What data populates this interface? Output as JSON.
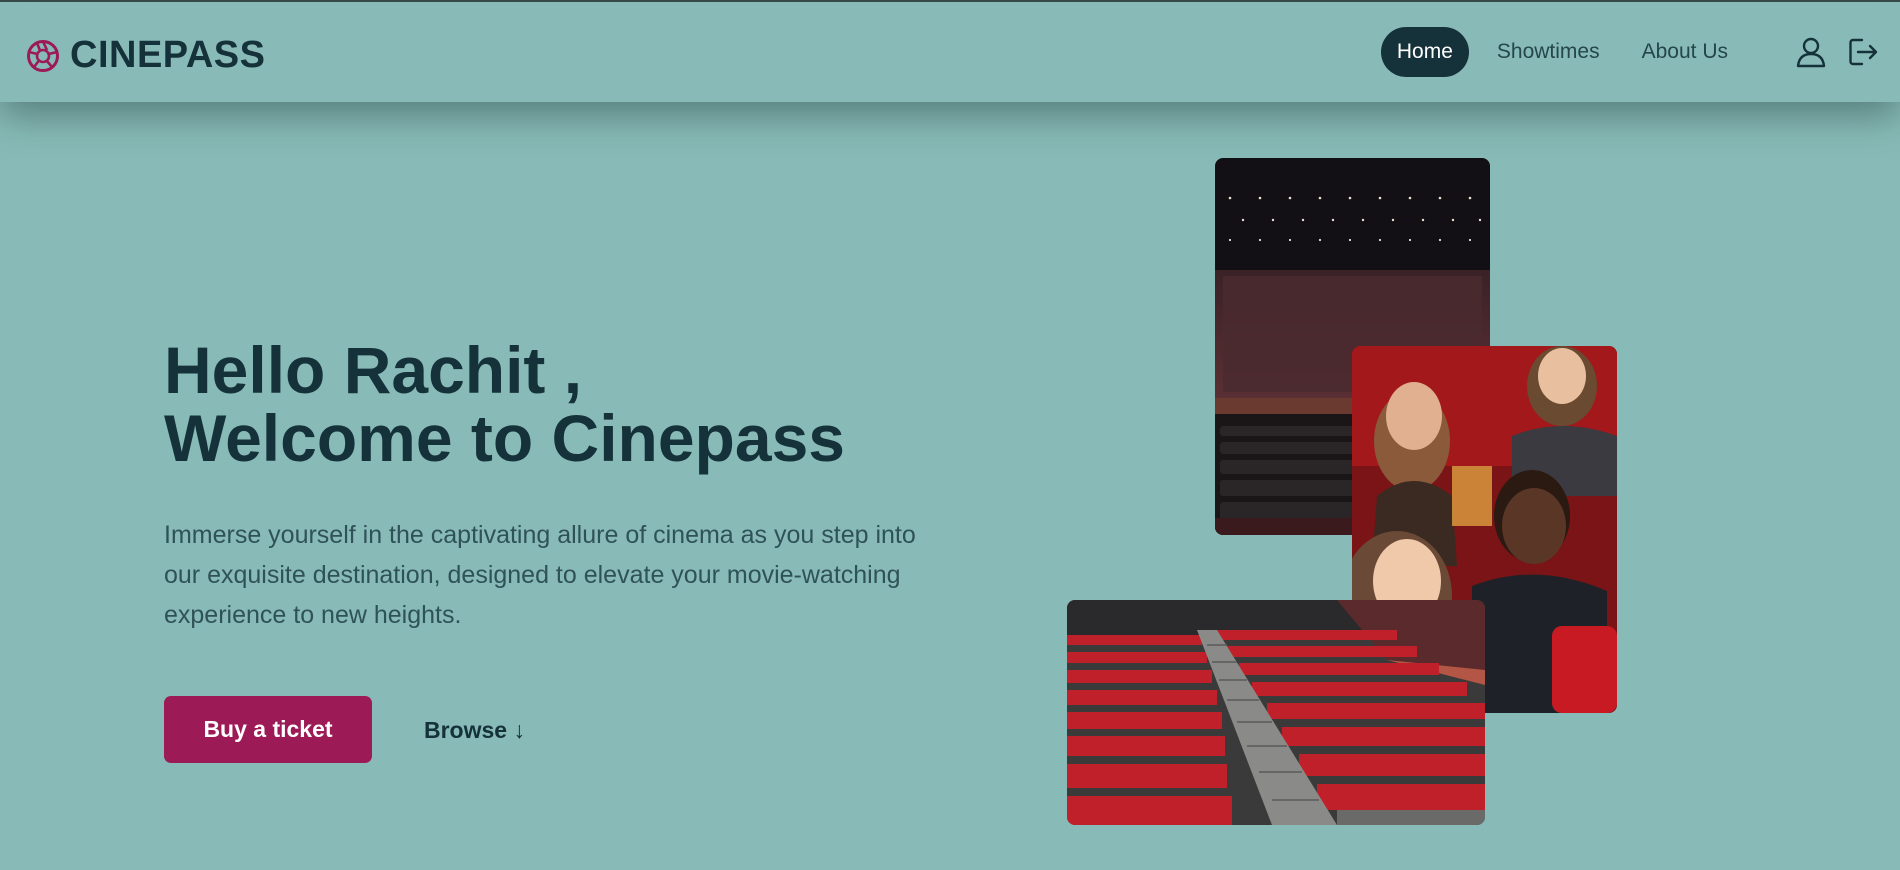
{
  "brand": {
    "name": "CINEPASS",
    "accent_color": "#9c1a55",
    "dark_color": "#15313a",
    "bg_color": "#88bbb7"
  },
  "nav": {
    "items": [
      {
        "label": "Home",
        "active": true
      },
      {
        "label": "Showtimes",
        "active": false
      },
      {
        "label": "About Us",
        "active": false
      }
    ],
    "icons": [
      "user-icon",
      "logout-icon"
    ]
  },
  "hero": {
    "title_line1": "Hello Rachit ,",
    "title_line2": "Welcome to Cinepass",
    "description": "Immerse yourself in the captivating allure of cinema as you step into our exquisite destination, designed to elevate your movie-watching experience to new heights.",
    "primary_button": "Buy a ticket",
    "secondary_button": "Browse ↓"
  },
  "images": [
    "cinema-screen-photo",
    "audience-photo",
    "red-seats-photo"
  ]
}
